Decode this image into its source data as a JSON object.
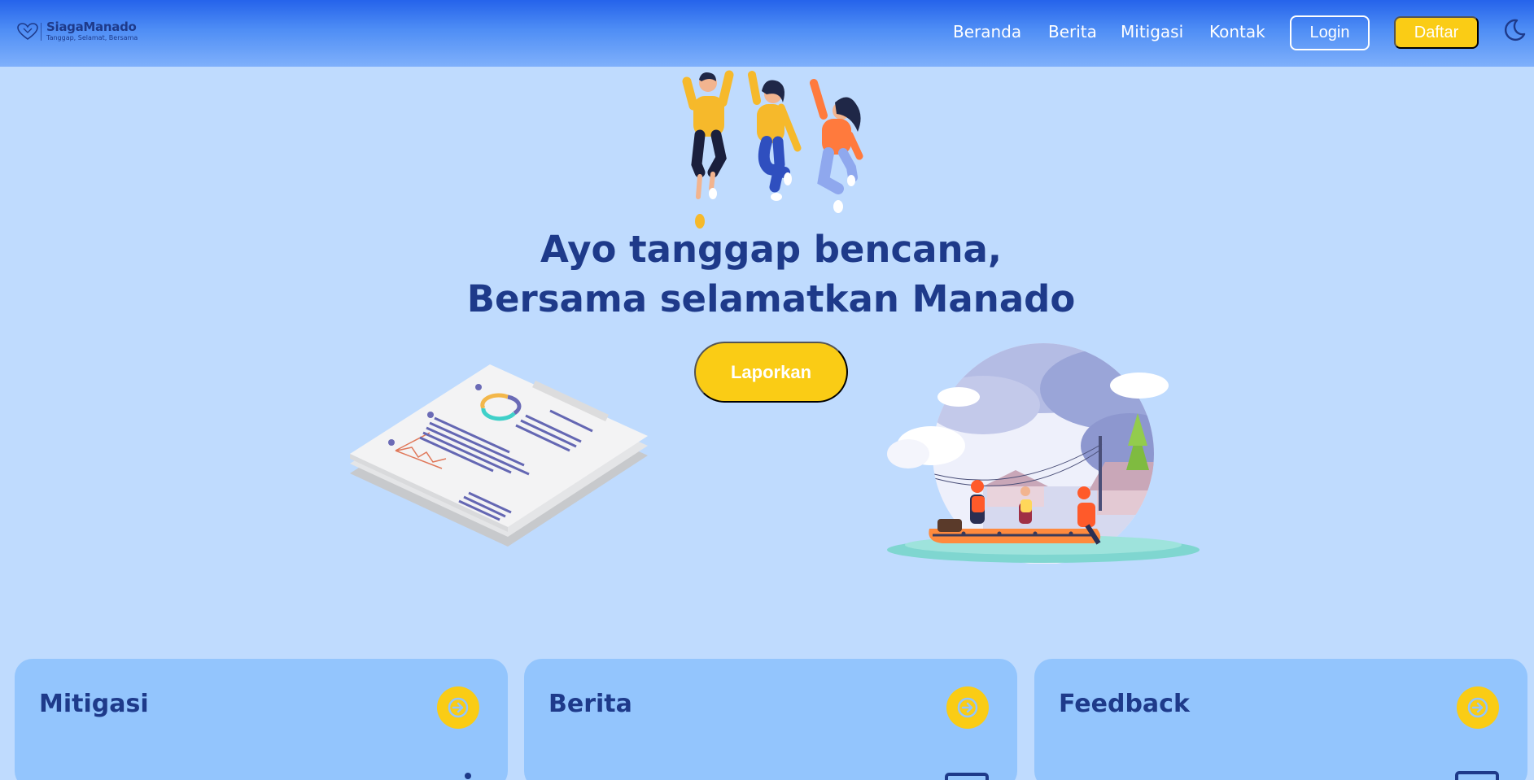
{
  "brand": {
    "name": "SiagaManado",
    "tagline": "Tanggap, Selamat, Bersama",
    "logo_icon": "heart-outline-icon"
  },
  "nav": {
    "links": [
      "Beranda",
      "Berita",
      "Mitigasi",
      "Kontak"
    ],
    "login_label": "Login",
    "register_label": "Daftar",
    "theme_icon": "moon-icon"
  },
  "hero": {
    "title_line1": "Ayo tanggap bencana,",
    "title_line2": "Bersama selamatkan Manado",
    "cta_label": "Laporkan"
  },
  "cards": [
    {
      "title": "Mitigasi",
      "arrow_icon": "arrow-right-icon"
    },
    {
      "title": "Berita",
      "arrow_icon": "arrow-right-icon"
    },
    {
      "title": "Feedback",
      "arrow_icon": "arrow-right-icon"
    }
  ],
  "colors": {
    "background": "#bfdbfe",
    "primary": "#1e3a8a",
    "accent": "#facc15",
    "card": "#93c5fd"
  }
}
